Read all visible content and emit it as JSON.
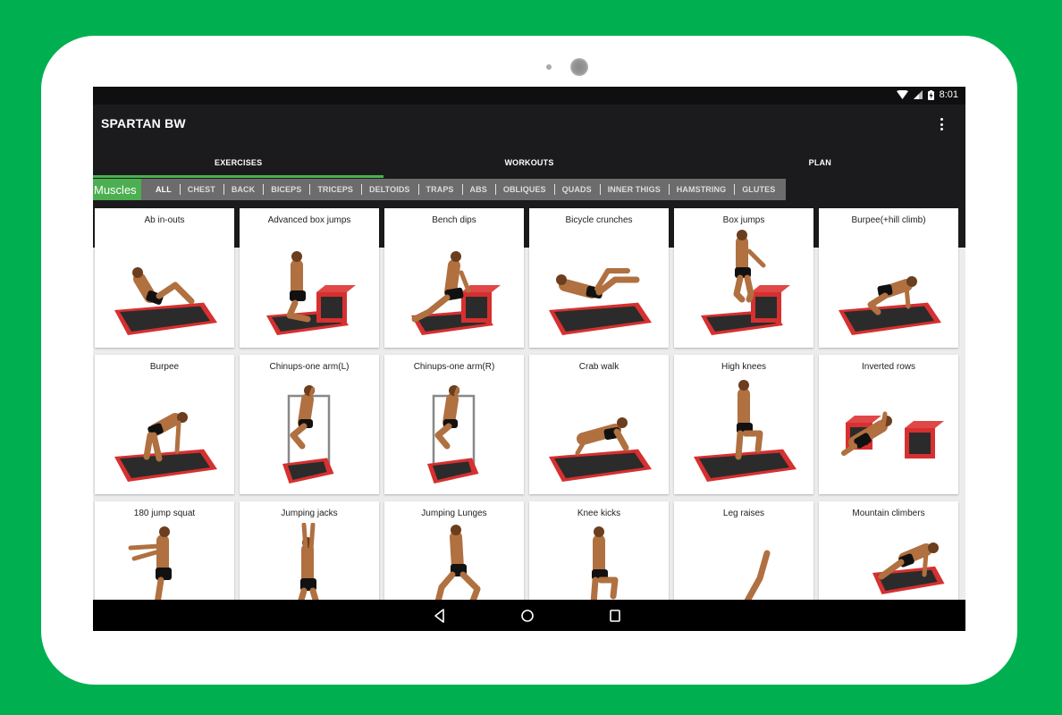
{
  "frame": {
    "background_color": "#00b050",
    "device_color": "#ffffff"
  },
  "status_bar": {
    "time": "8:01",
    "icons": [
      "wifi-icon",
      "cellular-signal-icon",
      "battery-charging-icon"
    ]
  },
  "app_bar": {
    "title": "SPARTAN BW",
    "overflow_icon": "more-vertical-icon"
  },
  "tabs": [
    {
      "label": "EXERCISES",
      "selected": true
    },
    {
      "label": "WORKOUTS",
      "selected": false
    },
    {
      "label": "PLAN",
      "selected": false
    }
  ],
  "filter": {
    "label": "Muscles",
    "chips": [
      {
        "label": "ALL",
        "active": true
      },
      {
        "label": "CHEST",
        "active": false
      },
      {
        "label": "BACK",
        "active": false
      },
      {
        "label": "BICEPS",
        "active": false
      },
      {
        "label": "TRICEPS",
        "active": false
      },
      {
        "label": "DELTOIDS",
        "active": false
      },
      {
        "label": "TRAPS",
        "active": false
      },
      {
        "label": "ABS",
        "active": false
      },
      {
        "label": "OBLIQUES",
        "active": false
      },
      {
        "label": "QUADS",
        "active": false
      },
      {
        "label": "INNER THIGS",
        "active": false
      },
      {
        "label": "HAMSTRING",
        "active": false
      },
      {
        "label": "GLUTES",
        "active": false
      }
    ]
  },
  "exercises": [
    {
      "name": "Ab in-outs",
      "equipment": "mat",
      "pose": "seated-crunch"
    },
    {
      "name": "Advanced box jumps",
      "equipment": "box",
      "pose": "kneeling"
    },
    {
      "name": "Bench dips",
      "equipment": "box",
      "pose": "dip"
    },
    {
      "name": "Bicycle crunches",
      "equipment": "mat",
      "pose": "lying-crunch"
    },
    {
      "name": "Box jumps",
      "equipment": "box",
      "pose": "standing-on-box"
    },
    {
      "name": "Burpee(+hill climb)",
      "equipment": "mat",
      "pose": "crawl"
    },
    {
      "name": "Burpee",
      "equipment": "mat",
      "pose": "bent-over"
    },
    {
      "name": "Chinups-one arm(L)",
      "equipment": "bar",
      "pose": "hanging"
    },
    {
      "name": "Chinups-one arm(R)",
      "equipment": "bar",
      "pose": "hanging"
    },
    {
      "name": "Crab walk",
      "equipment": "mat",
      "pose": "crab"
    },
    {
      "name": "High knees",
      "equipment": "mat",
      "pose": "standing"
    },
    {
      "name": "Inverted rows",
      "equipment": "boxes",
      "pose": "row"
    },
    {
      "name": "180 jump squat",
      "equipment": "mat",
      "pose": "standing-arms-forward"
    },
    {
      "name": "Jumping jacks",
      "equipment": "none",
      "pose": "arms-up"
    },
    {
      "name": "Jumping Lunges",
      "equipment": "none",
      "pose": "lunge"
    },
    {
      "name": "Knee kicks",
      "equipment": "none",
      "pose": "standing"
    },
    {
      "name": "Leg raises",
      "equipment": "mat",
      "pose": "legs-up"
    },
    {
      "name": "Mountain climbers",
      "equipment": "mat",
      "pose": "plank"
    }
  ],
  "nav_bar": {
    "buttons": [
      "back-icon",
      "home-icon",
      "recents-icon"
    ]
  }
}
